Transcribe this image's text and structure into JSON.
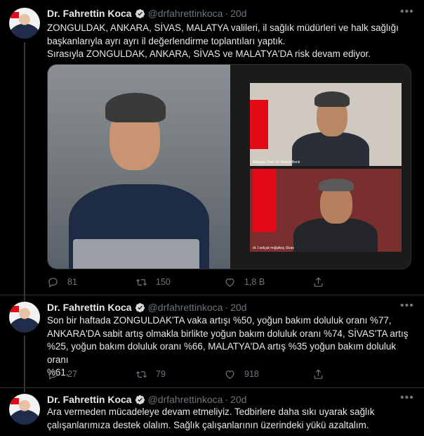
{
  "author": {
    "name": "Dr. Fahrettin Koca",
    "handle": "@drfahrettinkoca",
    "separator": "·",
    "date": "20d"
  },
  "tweets": [
    {
      "lines": [
        "ZONGULDAK, ANKARA, SİVAS, MALATYA valileri, il sağlık müdürleri ve halk sağlığı",
        "başkanlarıyla ayrı ayrı il değerlendirme toplantıları yaptık.",
        "Sırasıyla ZONGULDAK, ANKARA, SİVAS ve MALATYA'DA risk devam ediyor."
      ],
      "media": {
        "captions": [
          "Malatya, Prof. Dr. Recep Benli",
          "dr. f.selçuk mığulkoç Sivas"
        ]
      },
      "stats": {
        "replies": "81",
        "retweets": "150",
        "likes": "1,8 B"
      }
    },
    {
      "lines": [
        "Son bir haftada ZONGULDAK'TA  vaka artışı %50, yoğun bakım doluluk oranı %77,",
        "ANKARA'DA sabit artış olmakla birlikte yoğun bakım doluluk oranı %74, SİVAS'TA artış",
        "%25, yoğun bakım doluluk oranı %66, MALATYA'DA artış  %35 yoğun bakım doluluk oranı",
        "%61."
      ],
      "stats": {
        "replies": "27",
        "retweets": "79",
        "likes": "918"
      }
    },
    {
      "lines": [
        "Ara vermeden mücadeleye devam etmeliyiz. Tedbirlere daha sıkı uyarak sağlık",
        "çalışanlarımıza destek olalım. Sağlık çalışanlarının üzerindeki yükü azaltalım."
      ]
    }
  ],
  "icons": {
    "more": "more-icon",
    "reply": "reply-icon",
    "retweet": "retweet-icon",
    "like": "like-icon",
    "share": "share-icon",
    "verified": "verified-badge-icon"
  },
  "colors": {
    "background": "#000000",
    "verified": "#1d9bf0",
    "muted": "#6e767d",
    "text": "#e7e9ea"
  }
}
